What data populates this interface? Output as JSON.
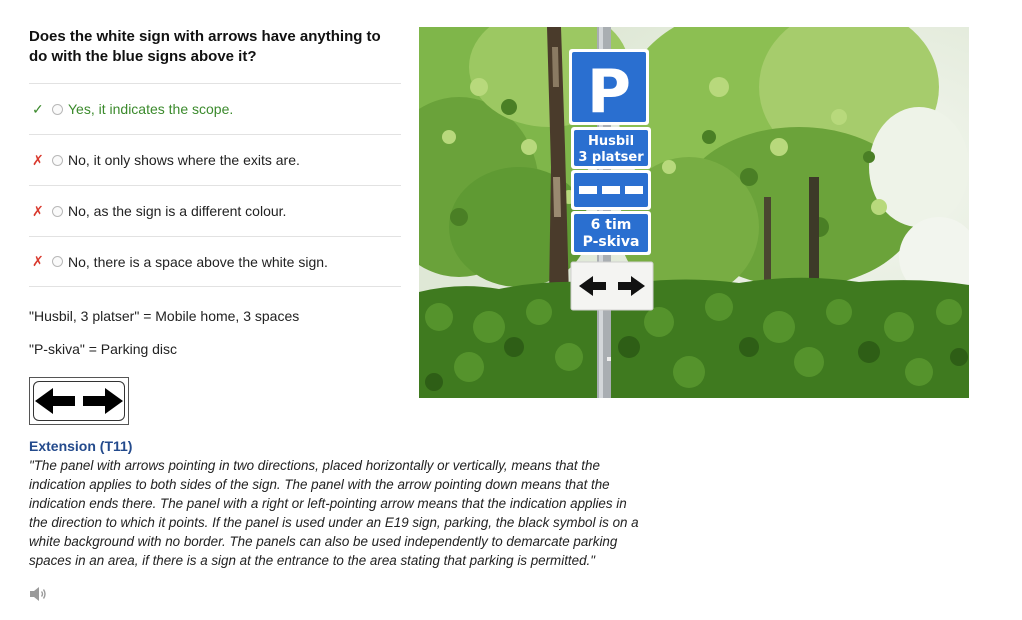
{
  "question": "Does the white sign with arrows have anything to do with the blue signs above it?",
  "answers": [
    {
      "mark": "✓",
      "status": "correct",
      "text": "Yes, it indicates the scope."
    },
    {
      "mark": "✗",
      "status": "wrong",
      "text": "No, it only shows where the exits are."
    },
    {
      "mark": "✗",
      "status": "wrong",
      "text": "No, as the sign is a different colour."
    },
    {
      "mark": "✗",
      "status": "wrong",
      "text": "No, there is a space above the white sign."
    }
  ],
  "notes": [
    "\"Husbil, 3 platser\" = Mobile home, 3 spaces",
    "\"P-skiva\" = Parking disc"
  ],
  "extension": {
    "title": "Extension (T11)",
    "text": "\"The panel with arrows pointing in two directions, placed horizontally or vertically, means that the indication applies to both sides of the sign. The panel with the arrow pointing down means that the indication ends there. The panel with a right or left-pointing arrow means that the indication applies in the direction to which it points. If the panel is used under an E19 sign, parking, the black symbol is on a white background with no border. The panels can also be used independently to demarcate parking spaces in an area, if there is a sign at the entrance to the area stating that parking is permitted.\""
  },
  "photo_signs": {
    "p_letter": "P",
    "husbil_line1": "Husbil",
    "husbil_line2": "3 platser",
    "tim_line1": "6 tim",
    "tim_line2": "P-skiva"
  },
  "icons": {
    "correct": "checkmark-icon",
    "wrong": "cross-icon",
    "audio": "speaker-icon",
    "arrows": "double-arrow-icon"
  },
  "colors": {
    "correct": "#3b8a2c",
    "wrong": "#d93a2e",
    "extension_title": "#234a8c",
    "sign_blue": "#2a6fd0"
  }
}
